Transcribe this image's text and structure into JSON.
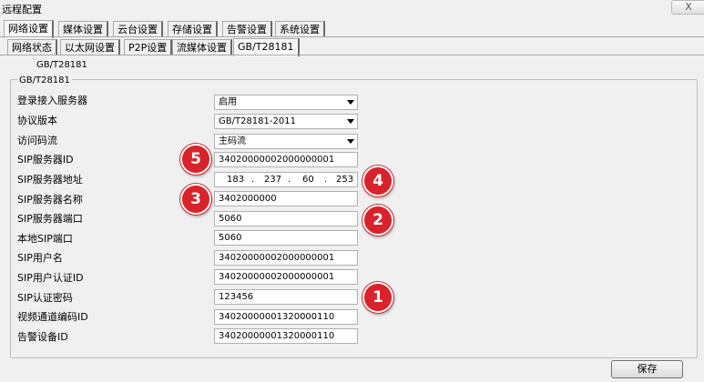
{
  "window": {
    "title": "远程配置",
    "close_label": "X"
  },
  "tabs_main": [
    "网络设置",
    "媒体设置",
    "云台设置",
    "存储设置",
    "告警设置",
    "系统设置"
  ],
  "tabs_sub": [
    "网络状态",
    "以太网设置",
    "P2P设置",
    "流媒体设置",
    "GB/T28181"
  ],
  "page_title": "GB/T28181",
  "group_title": "GB/T28181",
  "form": {
    "register_label": "登录接入服务器",
    "register_value": "启用",
    "protocol_label": "协议版本",
    "protocol_value": "GB/T28181-2011",
    "stream_label": "访问码流",
    "stream_value": "主码流",
    "sip_server_id_label": "SIP服务器ID",
    "sip_server_id_value": "34020000002000000001",
    "sip_server_addr_label": "SIP服务器地址",
    "sip_server_addr_octets": [
      "183",
      "237",
      "60",
      "253"
    ],
    "sip_server_name_label": "SIP服务器名称",
    "sip_server_name_value": "3402000000",
    "sip_server_port_label": "SIP服务器端口",
    "sip_server_port_value": "5060",
    "local_sip_port_label": "本地SIP端口",
    "local_sip_port_value": "5060",
    "sip_username_label": "SIP用户名",
    "sip_username_value": "34020000002000000001",
    "sip_auth_id_label": "SIP用户认证ID",
    "sip_auth_id_value": "34020000002000000001",
    "sip_password_label": "SIP认证密码",
    "sip_password_value": "123456",
    "video_channel_label": "视频通道编码ID",
    "video_channel_value": "34020000001320000110",
    "alarm_device_label": "告警设备ID",
    "alarm_device_value": "34020000001320000110"
  },
  "badges": [
    "1",
    "2",
    "3",
    "4",
    "5"
  ],
  "save_label": "保存",
  "colors": {
    "badge": "#d9222a",
    "background": "#f0f0f0"
  },
  "icons": {
    "dropdown": "chevron-down-icon",
    "close": "close-icon"
  }
}
